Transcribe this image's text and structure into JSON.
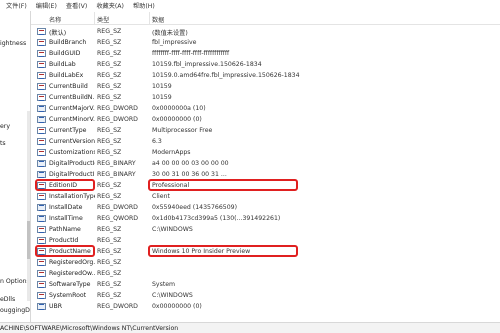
{
  "menu": [
    "文件(F)",
    "编辑(E)",
    "查看(V)",
    "收藏夹(A)",
    "帮助(H)"
  ],
  "tree_items": [
    "ightness",
    "ery",
    "ts",
    "n Options",
    "eDlls",
    "ouggingDl"
  ],
  "columns": {
    "name": "名称",
    "type": "类型",
    "data": "数据"
  },
  "rows": [
    {
      "name": "(默认)",
      "type": "REG_SZ",
      "data": "(数值未设置)",
      "icon": "string"
    },
    {
      "name": "BuildBranch",
      "type": "REG_SZ",
      "data": "fbl_impressive",
      "icon": "string"
    },
    {
      "name": "BuildGUID",
      "type": "REG_SZ",
      "data": "ffffffff-ffff-ffff-ffff-ffffffffffff",
      "icon": "string"
    },
    {
      "name": "BuildLab",
      "type": "REG_SZ",
      "data": "10159.fbl_impressive.150626-1834",
      "icon": "string"
    },
    {
      "name": "BuildLabEx",
      "type": "REG_SZ",
      "data": "10159.0.amd64fre.fbl_impressive.150626-1834",
      "icon": "string"
    },
    {
      "name": "CurrentBuild",
      "type": "REG_SZ",
      "data": "10159",
      "icon": "string"
    },
    {
      "name": "CurrentBuildN...",
      "type": "REG_SZ",
      "data": "10159",
      "icon": "string"
    },
    {
      "name": "CurrentMajorV...",
      "type": "REG_DWORD",
      "data": "0x0000000a (10)",
      "icon": "binary"
    },
    {
      "name": "CurrentMinorV...",
      "type": "REG_DWORD",
      "data": "0x00000000 (0)",
      "icon": "binary"
    },
    {
      "name": "CurrentType",
      "type": "REG_SZ",
      "data": "Multiprocessor Free",
      "icon": "string"
    },
    {
      "name": "CurrentVersion",
      "type": "REG_SZ",
      "data": "6.3",
      "icon": "string"
    },
    {
      "name": "Customizations",
      "type": "REG_SZ",
      "data": "ModernApps",
      "icon": "string"
    },
    {
      "name": "DigitalProductId",
      "type": "REG_BINARY",
      "data": "a4 00 00 00 03 00 00 00",
      "icon": "binary"
    },
    {
      "name": "DigitalProductI...",
      "type": "REG_BINARY",
      "data": "30 00 31 00 36 00 31 ...",
      "icon": "binary"
    },
    {
      "name": "EditionID",
      "type": "REG_SZ",
      "data": "Professional",
      "icon": "string"
    },
    {
      "name": "InstallationType",
      "type": "REG_SZ",
      "data": "Client",
      "icon": "string"
    },
    {
      "name": "InstallDate",
      "type": "REG_DWORD",
      "data": "0x55940eed (1435766509)",
      "icon": "binary"
    },
    {
      "name": "InstallTime",
      "type": "REG_QWORD",
      "data": "0x1d0b4173cd399a5 (130(...391492261)",
      "icon": "binary"
    },
    {
      "name": "PathName",
      "type": "REG_SZ",
      "data": "C:\\WINDOWS",
      "icon": "string"
    },
    {
      "name": "ProductId",
      "type": "REG_SZ",
      "data": "",
      "icon": "string"
    },
    {
      "name": "ProductName",
      "type": "REG_SZ",
      "data": "Windows 10 Pro Insider Preview",
      "icon": "string"
    },
    {
      "name": "RegisteredOrg...",
      "type": "REG_SZ",
      "data": "",
      "icon": "string"
    },
    {
      "name": "RegisteredOw...",
      "type": "REG_SZ",
      "data": "",
      "icon": "string"
    },
    {
      "name": "SoftwareType",
      "type": "REG_SZ",
      "data": "System",
      "icon": "string"
    },
    {
      "name": "SystemRoot",
      "type": "REG_SZ",
      "data": "C:\\WINDOWS",
      "icon": "string"
    },
    {
      "name": "UBR",
      "type": "REG_DWORD",
      "data": "0x00000000 (0)",
      "icon": "binary"
    }
  ],
  "highlighted": [
    "EditionID",
    "ProductName"
  ],
  "highlight_color": "#e02020",
  "status_path": "ACHINE\\SOFTWARE\\Microsoft\\Windows NT\\CurrentVersion"
}
